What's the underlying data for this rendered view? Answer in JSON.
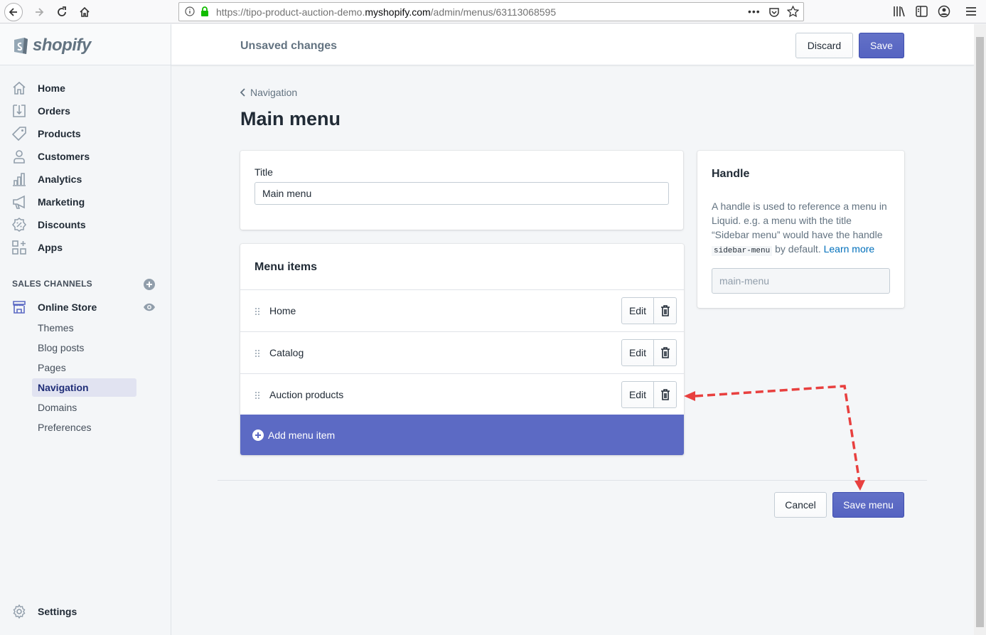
{
  "browser": {
    "url_prefix": "https://tipo-product-auction-demo.",
    "url_domain": "myshopify.com",
    "url_path": "/admin/menus/63113068595"
  },
  "brand": {
    "name": "shopify"
  },
  "sidebar": {
    "items": [
      {
        "label": "Home",
        "icon": "home-icon"
      },
      {
        "label": "Orders",
        "icon": "orders-icon"
      },
      {
        "label": "Products",
        "icon": "tag-icon"
      },
      {
        "label": "Customers",
        "icon": "person-icon"
      },
      {
        "label": "Analytics",
        "icon": "bar-chart-icon"
      },
      {
        "label": "Marketing",
        "icon": "megaphone-icon"
      },
      {
        "label": "Discounts",
        "icon": "discount-icon"
      },
      {
        "label": "Apps",
        "icon": "apps-icon"
      }
    ],
    "sales_channels_header": "SALES CHANNELS",
    "online_store": "Online Store",
    "sub_items": [
      "Themes",
      "Blog posts",
      "Pages",
      "Navigation",
      "Domains",
      "Preferences"
    ],
    "active_sub_item": "Navigation",
    "settings": "Settings"
  },
  "topbar": {
    "status": "Unsaved changes",
    "discard": "Discard",
    "save": "Save"
  },
  "page": {
    "breadcrumb": "Navigation",
    "title": "Main menu"
  },
  "title_card": {
    "label": "Title",
    "value": "Main menu"
  },
  "menu_card": {
    "heading": "Menu items",
    "items": [
      {
        "label": "Home",
        "edit": "Edit"
      },
      {
        "label": "Catalog",
        "edit": "Edit"
      },
      {
        "label": "Auction products",
        "edit": "Edit"
      }
    ],
    "add_label": "Add menu item"
  },
  "handle_card": {
    "heading": "Handle",
    "help_1": "A handle is used to reference a menu in Liquid. e.g. a menu with the title “Sidebar menu” would have the handle",
    "help_code": "sidebar-menu",
    "help_2": "by default.",
    "learn_more": "Learn more",
    "placeholder": "main-menu"
  },
  "footer": {
    "cancel": "Cancel",
    "save_menu": "Save menu"
  },
  "colors": {
    "primary": "#5c6ac4",
    "annotation_arrow": "#e8403f",
    "link": "#006fbb"
  }
}
